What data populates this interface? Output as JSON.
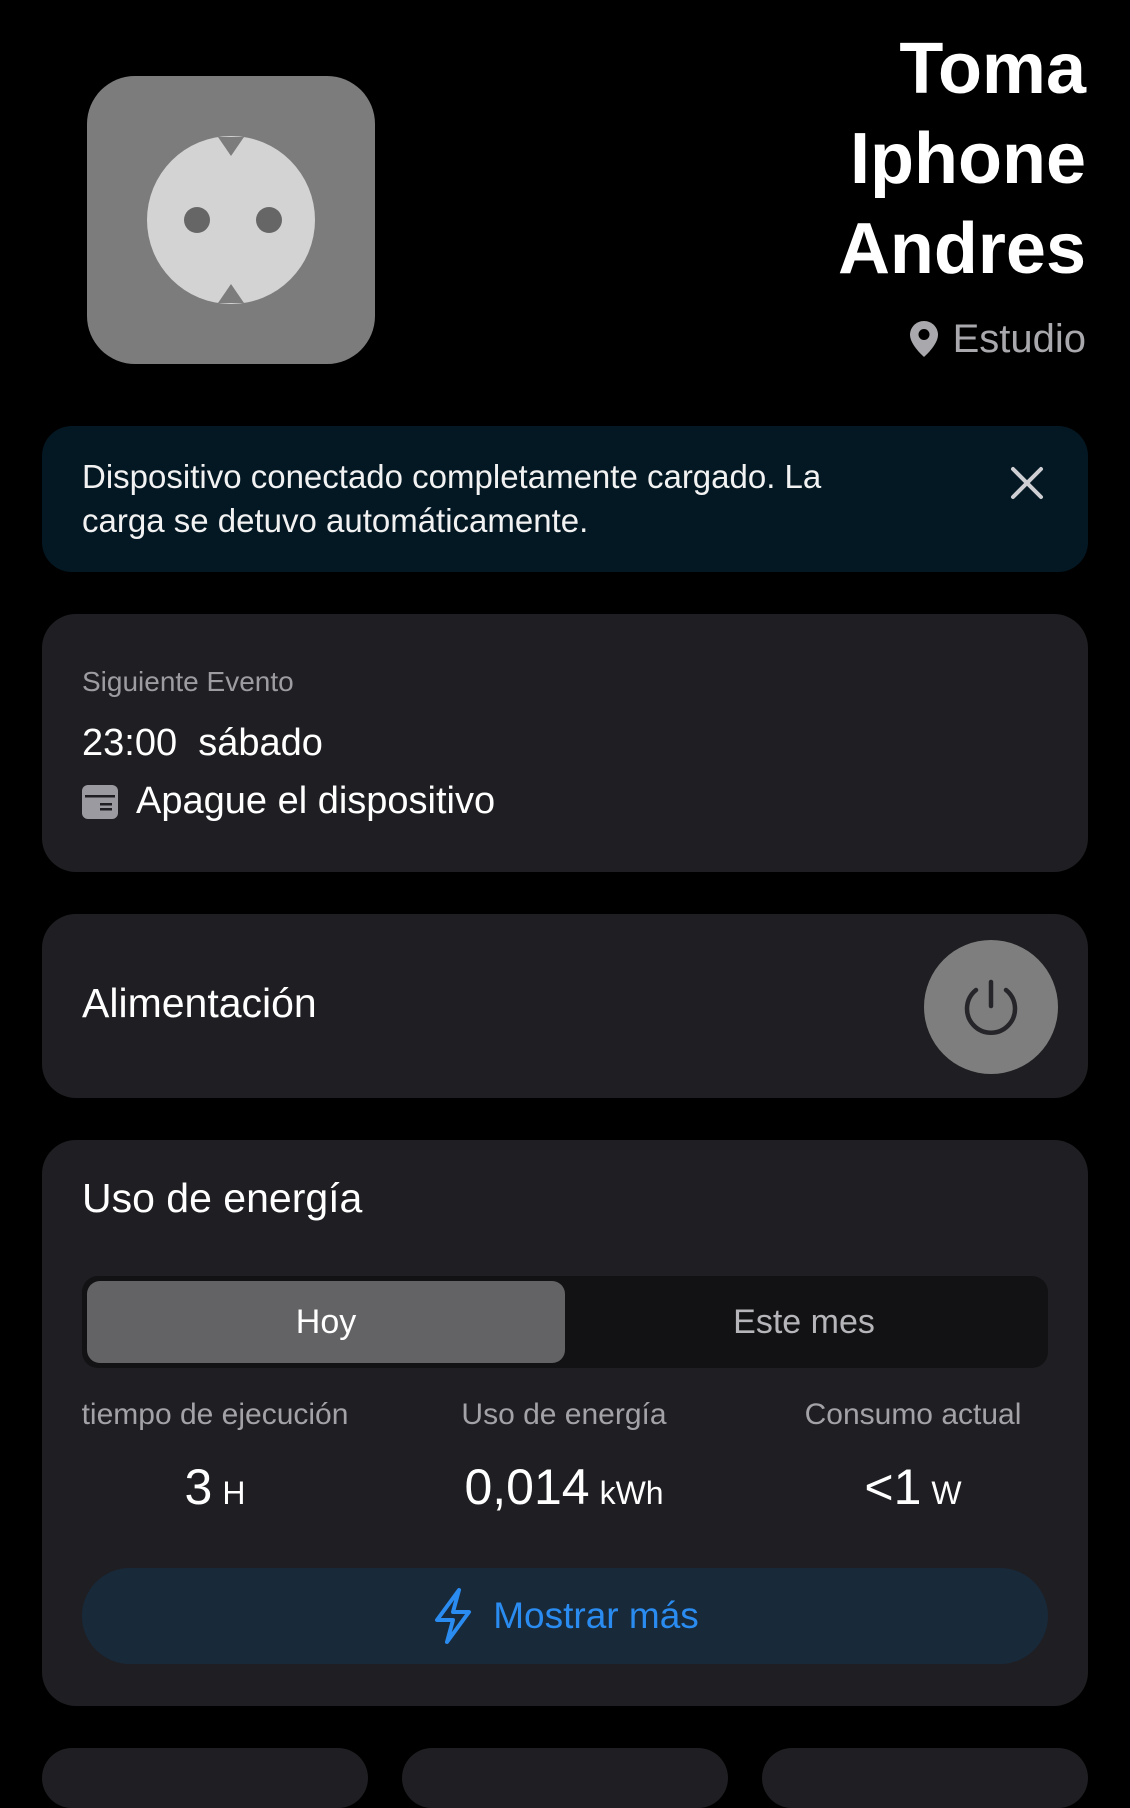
{
  "device": {
    "name": "Toma Iphone Andres",
    "name_lines": [
      "Toma",
      "Iphone",
      "Andres"
    ],
    "location": "Estudio",
    "icon": "power-outlet-icon"
  },
  "notification": {
    "text_line1": "Dispositivo conectado completamente cargado. La",
    "text_line2": "carga se detuvo automáticamente.",
    "close_icon": "close-icon"
  },
  "next_event": {
    "label": "Siguiente Evento",
    "time": "23:00",
    "day": "sábado",
    "action": "Apague el dispositivo",
    "icon": "calendar-icon"
  },
  "power": {
    "label": "Alimentación",
    "icon": "power-icon",
    "state": "off"
  },
  "energy": {
    "title": "Uso de energía",
    "tabs": [
      {
        "label": "Hoy",
        "selected": true
      },
      {
        "label": "Este mes",
        "selected": false
      }
    ],
    "stats": [
      {
        "label": "tiempo de ejecución",
        "value": "3",
        "unit": "H"
      },
      {
        "label": "Uso de energía",
        "value": "0,014",
        "unit": "kWh"
      },
      {
        "label": "Consumo actual",
        "value": "<1",
        "unit": "W"
      }
    ],
    "show_more": "Mostrar más",
    "show_more_icon": "lightning-icon"
  },
  "colors": {
    "background": "#000000",
    "card": "#1f1f23",
    "banner": "#041824",
    "accent": "#2a8cf0"
  }
}
